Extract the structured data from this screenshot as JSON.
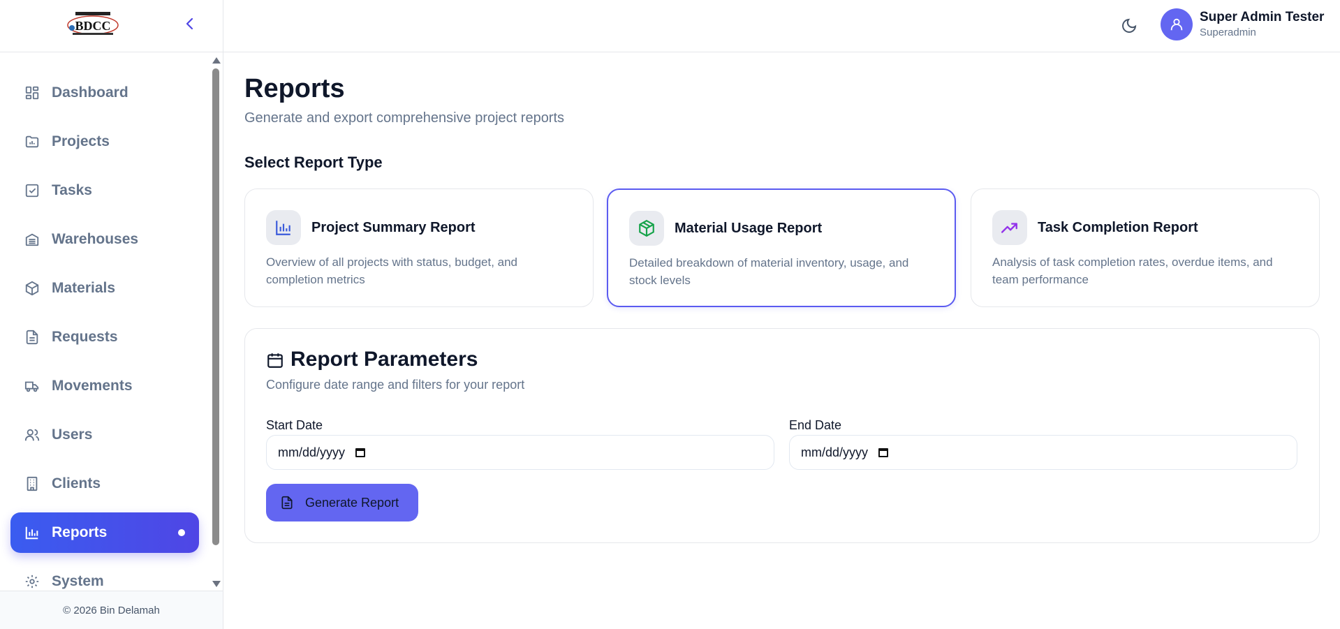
{
  "sidebar": {
    "logo_text": "BDCC",
    "items": [
      {
        "label": "Dashboard",
        "icon": "dashboard-icon"
      },
      {
        "label": "Projects",
        "icon": "folder-chart-icon"
      },
      {
        "label": "Tasks",
        "icon": "checkbox-icon"
      },
      {
        "label": "Warehouses",
        "icon": "warehouse-icon"
      },
      {
        "label": "Materials",
        "icon": "package-icon"
      },
      {
        "label": "Requests",
        "icon": "document-icon"
      },
      {
        "label": "Movements",
        "icon": "truck-icon"
      },
      {
        "label": "Users",
        "icon": "users-icon"
      },
      {
        "label": "Clients",
        "icon": "building-icon"
      },
      {
        "label": "Reports",
        "icon": "bar-chart-icon",
        "active": true
      },
      {
        "label": "System",
        "icon": "gear-icon"
      }
    ],
    "footer": "© 2026 Bin Delamah"
  },
  "header": {
    "user_name": "Super Admin Tester",
    "user_role": "Superadmin"
  },
  "main": {
    "title": "Reports",
    "subtitle": "Generate and export comprehensive project reports",
    "section_title": "Select Report Type",
    "report_types": [
      {
        "title": "Project Summary Report",
        "description": "Overview of all projects with status, budget, and completion metrics",
        "icon": "bar-chart-icon",
        "selected": false
      },
      {
        "title": "Material Usage Report",
        "description": "Detailed breakdown of material inventory, usage, and stock levels",
        "icon": "package-icon",
        "selected": true
      },
      {
        "title": "Task Completion Report",
        "description": "Analysis of task completion rates, overdue items, and team performance",
        "icon": "trending-up-icon",
        "selected": false
      }
    ],
    "params": {
      "title": "Report Parameters",
      "subtitle": "Configure date range and filters for your report",
      "start_label": "Start Date",
      "start_value": "mm/dd/yyyy",
      "end_label": "End Date",
      "end_value": "mm/dd/yyyy",
      "generate_label": "Generate Report"
    }
  },
  "colors": {
    "accent": "#6366f1",
    "active_nav": "#3a5cf0",
    "chart_icon": "#3b5bdb",
    "package_icon": "#16a34a",
    "trend_icon": "#9333ea"
  }
}
